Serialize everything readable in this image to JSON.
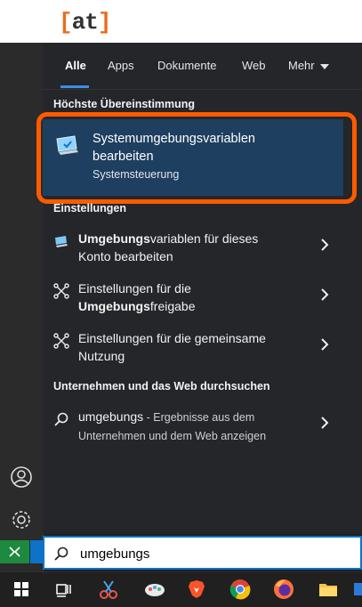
{
  "logo": {
    "bracket_left": "[",
    "text": "at",
    "bracket_right": "]"
  },
  "tabs": [
    {
      "label": "Alle",
      "active": true
    },
    {
      "label": "Apps"
    },
    {
      "label": "Dokumente"
    },
    {
      "label": "Web"
    },
    {
      "label": "Mehr"
    }
  ],
  "best_match": {
    "heading": "Höchste Übereinstimmung",
    "title_line1": "Systemumgebungsvariablen",
    "title_line2": "bearbeiten",
    "subtitle": "Systemsteuerung"
  },
  "settings": {
    "heading": "Einstellungen",
    "items": [
      {
        "bold": "Umgebungs",
        "rest": "variablen für dieses",
        "line2": "Konto bearbeiten"
      },
      {
        "pre": "Einstellungen für die",
        "bold": "Umgebungs",
        "rest": "freigabe"
      },
      {
        "line1": "Einstellungen für die gemeinsame",
        "line2": "Nutzung"
      }
    ]
  },
  "web": {
    "heading": "Unternehmen und das Web durchsuchen",
    "query": "umgebungs",
    "desc1": " - Ergebnisse aus dem",
    "desc2": "Unternehmen und dem Web anzeigen"
  },
  "search": {
    "value": "umgebungs"
  },
  "colors": {
    "accent": "#3a8ee6",
    "highlight": "#ff5a00",
    "best_bg": "#1e3f5f",
    "logo": "#e96c1b"
  },
  "taskbar_icons": [
    "windows-start-icon",
    "task-view-icon",
    "snipping-tool-icon",
    "paint-icon",
    "brave-icon",
    "chrome-icon",
    "firefox-icon",
    "file-explorer-icon",
    "overflow-icon"
  ]
}
